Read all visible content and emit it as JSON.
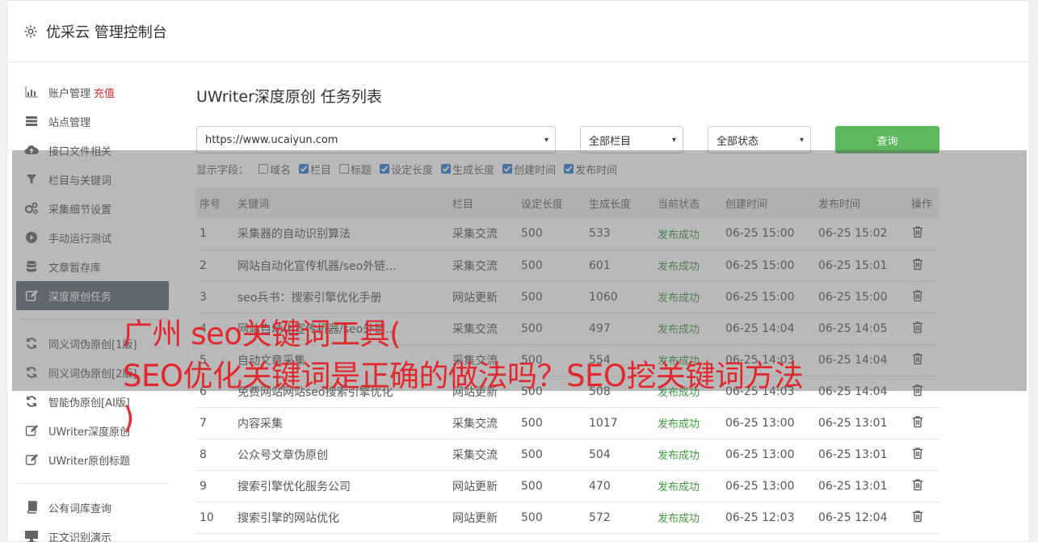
{
  "header": {
    "title": "优采云 管理控制台",
    "icon": "gear-icon"
  },
  "sidebar": {
    "items": [
      {
        "label": "账户管理",
        "badge": "充值",
        "icon": "bar-chart-icon"
      },
      {
        "label": "站点管理",
        "icon": "server-icon"
      },
      {
        "label": "接口文件相关",
        "icon": "cloud-upload-icon"
      },
      {
        "label": "栏目与关键词",
        "icon": "filter-icon"
      },
      {
        "label": "采集细节设置",
        "icon": "gears-icon"
      },
      {
        "label": "手动运行测试",
        "icon": "play-icon"
      },
      {
        "label": "文章暂存库",
        "icon": "database-icon"
      },
      {
        "label": "深度原创任务",
        "icon": "edit-icon"
      }
    ],
    "items2": [
      {
        "label": "同义词伪原创[1版]",
        "icon": "refresh-icon"
      },
      {
        "label": "同义词伪原创[2版]",
        "icon": "refresh-icon"
      },
      {
        "label": "智能伪原创[AI版]",
        "icon": "refresh-icon"
      },
      {
        "label": "UWriter深度原创",
        "icon": "edit-icon"
      },
      {
        "label": "UWriter原创标题",
        "icon": "edit-icon"
      }
    ],
    "items3": [
      {
        "label": "公有词库查询",
        "icon": "book-icon"
      },
      {
        "label": "正文识别演示",
        "icon": "monitor-icon"
      }
    ]
  },
  "main": {
    "title": "UWriter深度原创 任务列表",
    "site_select": "https://www.ucaiyun.com",
    "column_select": "全部栏目",
    "status_select": "全部状态",
    "query_label": "查询",
    "fields_label": "显示字段：",
    "fields": [
      {
        "label": "域名",
        "checked": false
      },
      {
        "label": "栏目",
        "checked": true
      },
      {
        "label": "标题",
        "checked": false
      },
      {
        "label": "设定长度",
        "checked": true
      },
      {
        "label": "生成长度",
        "checked": true
      },
      {
        "label": "创建时间",
        "checked": true
      },
      {
        "label": "发布时间",
        "checked": true
      }
    ],
    "columns": [
      "序号",
      "关键词",
      "栏目",
      "设定长度",
      "生成长度",
      "当前状态",
      "创建时间",
      "发布时间",
      "操作"
    ],
    "rows": [
      [
        "1",
        "采集器的自动识别算法",
        "采集交流",
        "500",
        "533",
        "发布成功",
        "06-25 15:00",
        "06-25 15:02"
      ],
      [
        "2",
        "网站自动化宣传机器/seo外链...",
        "采集交流",
        "500",
        "601",
        "发布成功",
        "06-25 15:00",
        "06-25 15:01"
      ],
      [
        "3",
        "seo兵书：搜索引擎优化手册",
        "网站更新",
        "500",
        "1060",
        "发布成功",
        "06-25 15:00",
        "06-25 15:00"
      ],
      [
        "4",
        "网站自动化宣传机器/seo外链...",
        "采集交流",
        "500",
        "497",
        "发布成功",
        "06-25 14:04",
        "06-25 14:05"
      ],
      [
        "5",
        "自动文章采集",
        "采集交流",
        "500",
        "554",
        "发布成功",
        "06-25 14:03",
        "06-25 14:04"
      ],
      [
        "6",
        "免费网站网站seo搜索引擎优化",
        "网站更新",
        "500",
        "508",
        "发布成功",
        "06-25 14:03",
        "06-25 14:04"
      ],
      [
        "7",
        "内容采集",
        "采集交流",
        "500",
        "1017",
        "发布成功",
        "06-25 13:00",
        "06-25 13:01"
      ],
      [
        "8",
        "公众号文章伪原创",
        "采集交流",
        "500",
        "504",
        "发布成功",
        "06-25 13:00",
        "06-25 13:01"
      ],
      [
        "9",
        "搜索引擎优化服务公司",
        "网站更新",
        "500",
        "470",
        "发布成功",
        "06-25 13:00",
        "06-25 13:01"
      ],
      [
        "10",
        "搜索引擎的网站优化",
        "网站更新",
        "500",
        "572",
        "发布成功",
        "06-25 12:03",
        "06-25 12:04"
      ]
    ]
  },
  "overlay": {
    "line1": "广州 seo关键词工具(",
    "line2": "SEO优化关键词是正确的做法吗？SEO挖关键词方法",
    "line3": ")"
  },
  "colors": {
    "accent_green": "#5cb85c",
    "active_sidebar": "#5f6b7a",
    "status_green": "#3c9a3c",
    "headline_red": "#e0282e"
  }
}
